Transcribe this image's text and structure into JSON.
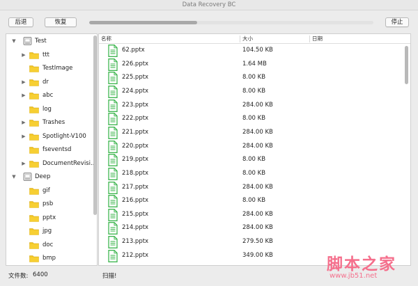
{
  "window": {
    "title": "Data Recovery BC"
  },
  "toolbar": {
    "back_label": "后退",
    "restore_label": "恢复",
    "stop_label": "停止",
    "progress": 0.38
  },
  "tree": {
    "items": [
      {
        "label": "Test",
        "kind": "drive",
        "level": 0,
        "expanded": true
      },
      {
        "label": "ttt",
        "kind": "folder",
        "level": 1,
        "has_children": true
      },
      {
        "label": "TestImage",
        "kind": "folder",
        "level": 1,
        "has_children": false
      },
      {
        "label": "dr",
        "kind": "folder",
        "level": 1,
        "has_children": true
      },
      {
        "label": "abc",
        "kind": "folder",
        "level": 1,
        "has_children": true
      },
      {
        "label": "log",
        "kind": "folder",
        "level": 1,
        "has_children": false
      },
      {
        "label": "Trashes",
        "kind": "folder",
        "level": 1,
        "has_children": true
      },
      {
        "label": "Spotlight-V100",
        "kind": "folder",
        "level": 1,
        "has_children": true
      },
      {
        "label": "fseventsd",
        "kind": "folder",
        "level": 1,
        "has_children": false
      },
      {
        "label": "DocumentRevisi...",
        "kind": "folder",
        "level": 1,
        "has_children": true
      },
      {
        "label": "Deep",
        "kind": "drive",
        "level": 0,
        "expanded": true
      },
      {
        "label": "gif",
        "kind": "folder",
        "level": 1,
        "has_children": false
      },
      {
        "label": "psb",
        "kind": "folder",
        "level": 1,
        "has_children": false
      },
      {
        "label": "pptx",
        "kind": "folder",
        "level": 1,
        "has_children": false
      },
      {
        "label": "jpg",
        "kind": "folder",
        "level": 1,
        "has_children": false
      },
      {
        "label": "doc",
        "kind": "folder",
        "level": 1,
        "has_children": false
      },
      {
        "label": "bmp",
        "kind": "folder",
        "level": 1,
        "has_children": false
      }
    ]
  },
  "table": {
    "columns": {
      "name": "名称",
      "size": "大小",
      "date": "日期"
    },
    "rows": [
      {
        "name": "62.pptx",
        "size": "104.50 KB"
      },
      {
        "name": "226.pptx",
        "size": "1.64 MB"
      },
      {
        "name": "225.pptx",
        "size": "8.00 KB"
      },
      {
        "name": "224.pptx",
        "size": "8.00 KB"
      },
      {
        "name": "223.pptx",
        "size": "284.00 KB"
      },
      {
        "name": "222.pptx",
        "size": "8.00 KB"
      },
      {
        "name": "221.pptx",
        "size": "284.00 KB"
      },
      {
        "name": "220.pptx",
        "size": "284.00 KB"
      },
      {
        "name": "219.pptx",
        "size": "8.00 KB"
      },
      {
        "name": "218.pptx",
        "size": "8.00 KB"
      },
      {
        "name": "217.pptx",
        "size": "284.00 KB"
      },
      {
        "name": "216.pptx",
        "size": "8.00 KB"
      },
      {
        "name": "215.pptx",
        "size": "284.00 KB"
      },
      {
        "name": "214.pptx",
        "size": "284.00 KB"
      },
      {
        "name": "213.pptx",
        "size": "279.50 KB"
      },
      {
        "name": "212.pptx",
        "size": "349.00 KB"
      }
    ]
  },
  "status": {
    "count_label": "文件数:",
    "count_value": "6400",
    "message": "扫描!"
  },
  "watermark": {
    "text": "脚本之家",
    "url": "www.jb51.net"
  },
  "colors": {
    "folder": "#f3c623",
    "file_icon": "#3fb650",
    "watermark": "#f56f8c"
  }
}
